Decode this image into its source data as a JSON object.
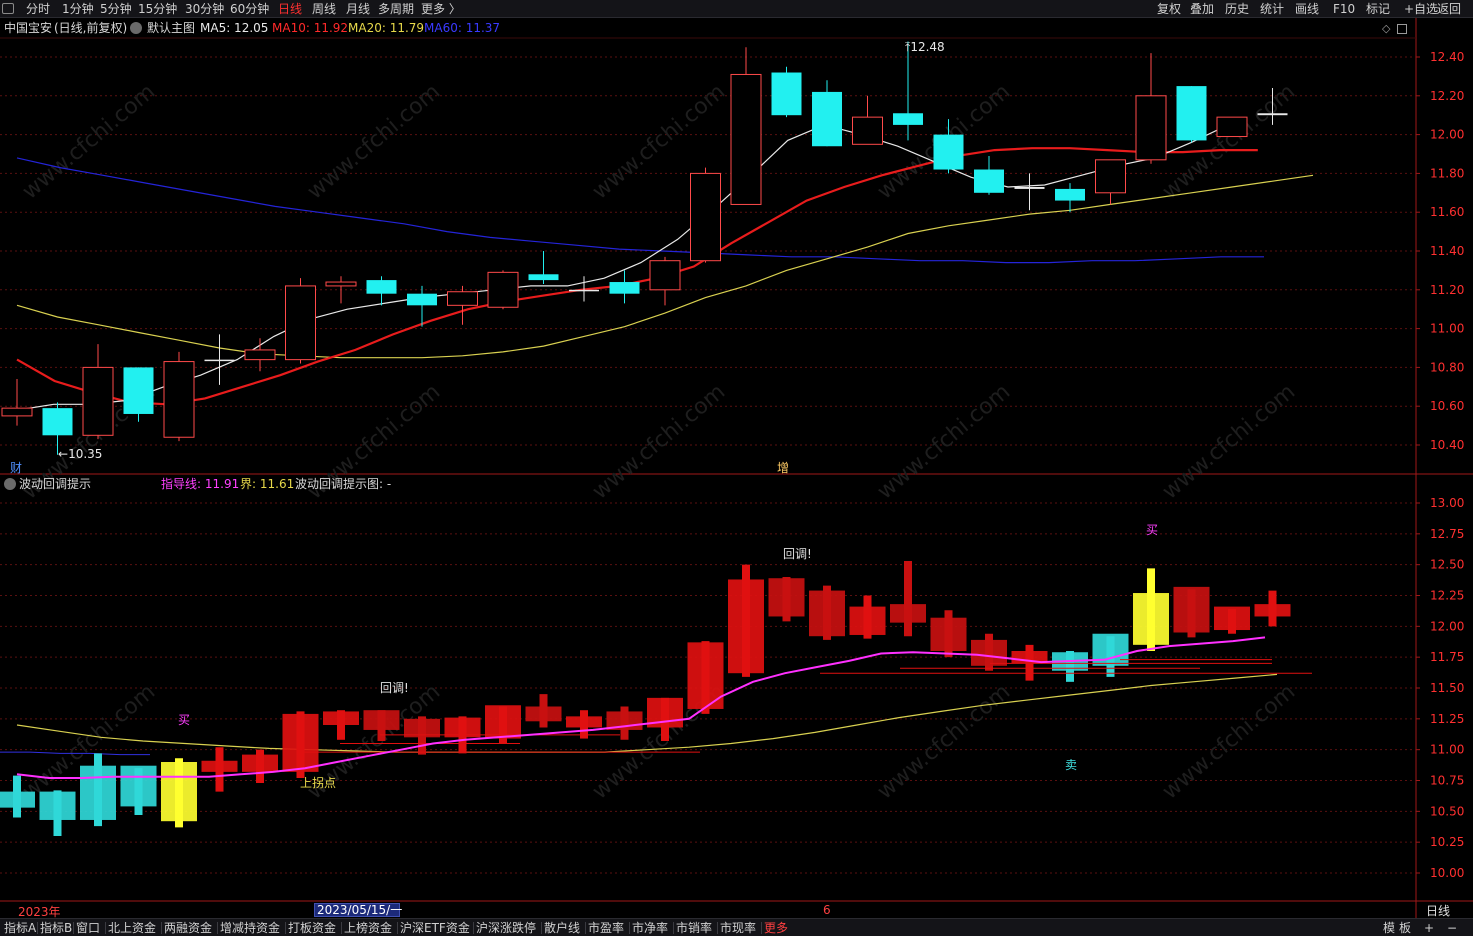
{
  "window": {
    "timeframes": [
      "分时",
      "1分钟",
      "5分钟",
      "15分钟",
      "30分钟",
      "60分钟",
      "日线",
      "周线",
      "月线",
      "多周期",
      "更多 〉"
    ],
    "active_timeframe": "日线",
    "right_tools": [
      "复权",
      "叠加",
      "历史",
      "统计",
      "画线",
      "F10",
      "标记",
      "+自选",
      "返回"
    ]
  },
  "main_chart": {
    "stock_name": "中国宝安",
    "adjust": "(日线,前复权)",
    "template": "默认主图",
    "ma": [
      {
        "label": "MA5: 12.05",
        "color": "#e8e8e8"
      },
      {
        "label": "MA10: 11.92",
        "color": "#ff2a2a"
      },
      {
        "label": "MA20: 11.79",
        "color": "#e6d84a"
      },
      {
        "label": "MA60: 11.37",
        "color": "#3a3aff"
      }
    ],
    "high_label": "12.48",
    "low_label": "10.35",
    "marker_cai": "财",
    "marker_zeng": "增",
    "y_ticks": [
      "12.40",
      "12.20",
      "12.00",
      "11.80",
      "11.60",
      "11.40",
      "11.20",
      "11.00",
      "10.80",
      "10.60",
      "10.40"
    ]
  },
  "indicator": {
    "name": "波动回调提示",
    "guide_label": "指导线: 11.91",
    "bound_label": "界: 11.61",
    "hint_label": "波动回调提示图: -",
    "annotations": {
      "buy1": "买",
      "buy2": "买",
      "sell": "卖",
      "pullback1": "回调!",
      "pullback2": "回调!",
      "turn_point": "上拐点"
    },
    "y_ticks": [
      "13.00",
      "12.75",
      "12.50",
      "12.25",
      "12.00",
      "11.75",
      "11.50",
      "11.25",
      "11.00",
      "10.75",
      "10.50",
      "10.25",
      "10.00"
    ]
  },
  "x_axis": {
    "year_label": "2023年",
    "date_label": "2023/05/15/一",
    "month_label": "6",
    "period_label": "日线"
  },
  "bottom_tabs": [
    "指标A",
    "指标B",
    "窗口",
    "北上资金",
    "两融资金",
    "增减持资金",
    "打板资金",
    "上榜资金",
    "沪深ETF资金",
    "沪深涨跌停",
    "散户线",
    "市盈率",
    "市净率",
    "市销率",
    "市现率",
    "更多"
  ],
  "bottom_right": [
    "模",
    "板",
    "+",
    "−"
  ],
  "chart_data": {
    "type": "candlestick",
    "candles": [
      {
        "o": 10.55,
        "h": 10.74,
        "l": 10.5,
        "c": 10.59
      },
      {
        "o": 10.59,
        "h": 10.62,
        "l": 10.35,
        "c": 10.45
      },
      {
        "o": 10.45,
        "h": 10.92,
        "l": 10.43,
        "c": 10.8
      },
      {
        "o": 10.8,
        "h": 10.8,
        "l": 10.52,
        "c": 10.56
      },
      {
        "o": 10.44,
        "h": 10.88,
        "l": 10.42,
        "c": 10.83
      },
      {
        "o": 10.84,
        "h": 10.97,
        "l": 10.71,
        "c": 10.84
      },
      {
        "o": 10.84,
        "h": 10.95,
        "l": 10.78,
        "c": 10.89
      },
      {
        "o": 10.84,
        "h": 11.26,
        "l": 10.82,
        "c": 11.22
      },
      {
        "o": 11.22,
        "h": 11.27,
        "l": 11.13,
        "c": 11.24
      },
      {
        "o": 11.25,
        "h": 11.27,
        "l": 11.12,
        "c": 11.18
      },
      {
        "o": 11.18,
        "h": 11.22,
        "l": 11.01,
        "c": 11.12
      },
      {
        "o": 11.12,
        "h": 11.22,
        "l": 11.02,
        "c": 11.19
      },
      {
        "o": 11.11,
        "h": 11.3,
        "l": 11.1,
        "c": 11.29
      },
      {
        "o": 11.28,
        "h": 11.4,
        "l": 11.23,
        "c": 11.25
      },
      {
        "o": 11.2,
        "h": 11.27,
        "l": 11.14,
        "c": 11.2
      },
      {
        "o": 11.24,
        "h": 11.3,
        "l": 11.13,
        "c": 11.18
      },
      {
        "o": 11.2,
        "h": 11.37,
        "l": 11.12,
        "c": 11.35
      },
      {
        "o": 11.35,
        "h": 11.83,
        "l": 11.34,
        "c": 11.8
      },
      {
        "o": 11.64,
        "h": 12.45,
        "l": 11.64,
        "c": 12.31
      },
      {
        "o": 12.32,
        "h": 12.35,
        "l": 12.09,
        "c": 12.1
      },
      {
        "o": 12.22,
        "h": 12.28,
        "l": 11.94,
        "c": 11.94
      },
      {
        "o": 11.95,
        "h": 12.2,
        "l": 11.95,
        "c": 12.09
      },
      {
        "o": 12.11,
        "h": 12.48,
        "l": 11.97,
        "c": 12.05
      },
      {
        "o": 12.0,
        "h": 12.08,
        "l": 11.8,
        "c": 11.82
      },
      {
        "o": 11.82,
        "h": 11.89,
        "l": 11.69,
        "c": 11.7
      },
      {
        "o": 11.73,
        "h": 11.8,
        "l": 11.61,
        "c": 11.72
      },
      {
        "o": 11.72,
        "h": 11.75,
        "l": 11.6,
        "c": 11.66
      },
      {
        "o": 11.7,
        "h": 11.87,
        "l": 11.64,
        "c": 11.87
      },
      {
        "o": 11.87,
        "h": 12.42,
        "l": 11.85,
        "c": 12.2
      },
      {
        "o": 12.25,
        "h": 12.25,
        "l": 11.96,
        "c": 11.97
      },
      {
        "o": 11.99,
        "h": 12.09,
        "l": 11.99,
        "c": 12.09
      },
      {
        "o": 12.1,
        "h": 12.24,
        "l": 12.05,
        "c": 12.11
      }
    ],
    "candle_colors": [
      "up",
      "down",
      "up",
      "down",
      "up",
      "flat",
      "up",
      "up",
      "up",
      "down",
      "down",
      "up",
      "up",
      "down",
      "flat",
      "down",
      "up",
      "up",
      "up",
      "down",
      "down",
      "up",
      "down",
      "down",
      "down",
      "flat",
      "down",
      "up",
      "up",
      "down",
      "up",
      "flat"
    ],
    "ma5": [
      10.58,
      10.61,
      10.61,
      10.63,
      10.7,
      10.76,
      10.84,
      10.96,
      11.05,
      11.1,
      11.13,
      11.16,
      11.18,
      11.2,
      11.22,
      11.22,
      11.26,
      11.34,
      11.46,
      11.62,
      11.79,
      11.97,
      12.05,
      12.0,
      11.94,
      11.86,
      11.78,
      11.73,
      11.74,
      11.79,
      11.84,
      11.88,
      11.96,
      12.05
    ],
    "ma10": [
      10.84,
      10.73,
      10.67,
      10.62,
      10.61,
      10.64,
      10.7,
      10.76,
      10.83,
      10.89,
      10.97,
      11.04,
      11.1,
      11.14,
      11.17,
      11.2,
      11.22,
      11.26,
      11.32,
      11.44,
      11.55,
      11.66,
      11.73,
      11.79,
      11.84,
      11.89,
      11.92,
      11.93,
      11.93,
      11.92,
      11.91,
      11.91,
      11.92,
      11.92
    ],
    "ma20": [
      11.12,
      11.06,
      11.02,
      10.98,
      10.94,
      10.9,
      10.87,
      10.86,
      10.85,
      10.85,
      10.85,
      10.86,
      10.88,
      10.91,
      10.96,
      11.01,
      11.08,
      11.16,
      11.22,
      11.3,
      11.36,
      11.42,
      11.49,
      11.53,
      11.56,
      11.59,
      11.61,
      11.64,
      11.67,
      11.7,
      11.73,
      11.76,
      11.79
    ],
    "ma60": [
      11.88,
      11.83,
      11.79,
      11.75,
      11.71,
      11.67,
      11.63,
      11.6,
      11.57,
      11.54,
      11.5,
      11.47,
      11.45,
      11.43,
      11.41,
      11.4,
      11.39,
      11.38,
      11.37,
      11.37,
      11.36,
      11.35,
      11.35,
      11.34,
      11.34,
      11.35,
      11.35,
      11.36,
      11.37,
      11.37
    ],
    "guide_line": [
      10.8,
      10.77,
      10.77,
      10.78,
      10.78,
      10.78,
      10.78,
      10.8,
      10.82,
      10.85,
      10.9,
      10.95,
      11.0,
      11.05,
      11.08,
      11.1,
      11.12,
      11.14,
      11.16,
      11.19,
      11.22,
      11.25,
      11.43,
      11.55,
      11.62,
      11.67,
      11.72,
      11.78,
      11.79,
      11.78,
      11.77,
      11.74,
      11.71,
      11.72,
      11.73,
      11.8,
      11.84,
      11.86,
      11.88,
      11.91
    ],
    "bound_line": [
      11.2,
      11.15,
      11.1,
      11.07,
      11.05,
      11.03,
      11.01,
      11.0,
      10.99,
      10.98,
      10.98,
      10.98,
      10.98,
      10.98,
      10.98,
      11.0,
      11.02,
      11.05,
      11.09,
      11.14,
      11.2,
      11.26,
      11.31,
      11.36,
      11.4,
      11.44,
      11.48,
      11.52,
      11.55,
      11.58,
      11.61
    ]
  }
}
